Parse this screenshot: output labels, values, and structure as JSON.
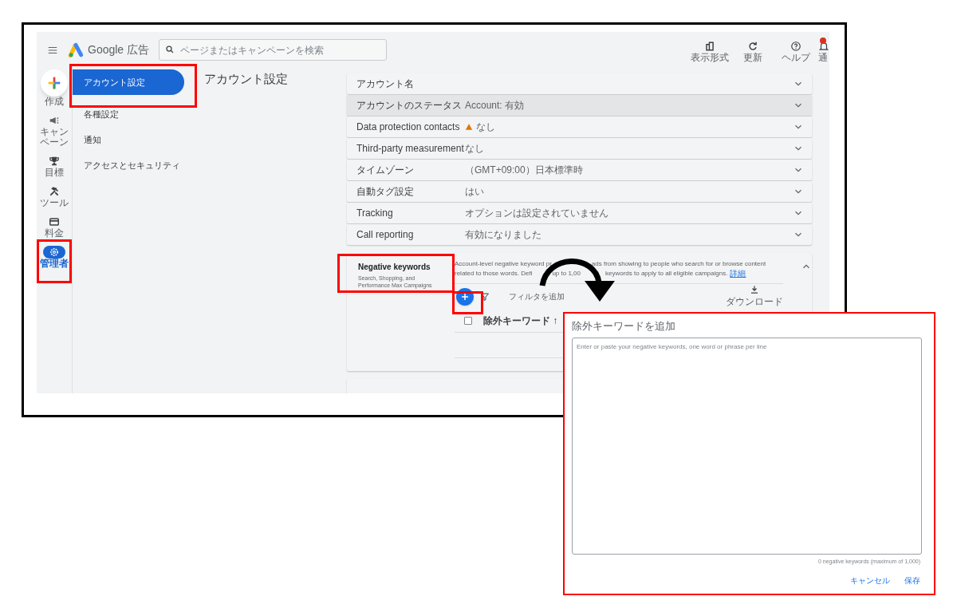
{
  "top_bar": {
    "product": "Google 広告",
    "search": {
      "placeholder": "ページまたはキャンペーンを検索"
    },
    "actions": [
      {
        "kind": "layout",
        "label": "表示形式"
      },
      {
        "kind": "refresh",
        "label": "更新"
      },
      {
        "kind": "help",
        "label": "ヘルプ"
      },
      {
        "kind": "bell",
        "label": "通",
        "badge": true
      }
    ]
  },
  "nav_rail": [
    {
      "kind": "create",
      "label": "作成",
      "selected": false
    },
    {
      "kind": "megaphone",
      "label": "キャンペーン",
      "selected": false
    },
    {
      "kind": "trophy",
      "label": "目標",
      "selected": false
    },
    {
      "kind": "tools",
      "label": "ツール",
      "selected": false
    },
    {
      "kind": "card",
      "label": "料金",
      "selected": false
    },
    {
      "kind": "gear",
      "label": "管理者",
      "selected": true
    }
  ],
  "sub_nav": [
    {
      "label": "アカウント設定",
      "selected": true
    },
    {
      "label": "各種設定",
      "selected": false
    },
    {
      "label": "通知",
      "selected": false
    },
    {
      "label": "アクセスとセキュリティ",
      "selected": false
    }
  ],
  "page_title": "アカウント設定",
  "settings": [
    {
      "label": "アカウント名",
      "highlighted": false,
      "warning": false
    },
    {
      "label": "アカウントのステータス",
      "value": "Account: 有効",
      "highlighted": true,
      "warning": false
    },
    {
      "label": "Data protection contacts",
      "value": "なし",
      "highlighted": false,
      "warning": true
    },
    {
      "label": "Third-party measurement",
      "value": "なし",
      "highlighted": false,
      "warning": false
    },
    {
      "label": "タイムゾーン",
      "value": "（GMT+09:00）日本標準時",
      "highlighted": false,
      "warning": false
    },
    {
      "label": "自動タグ設定",
      "value": "はい",
      "highlighted": false,
      "warning": false
    },
    {
      "label": "Tracking",
      "value": "オプションは設定されていません",
      "highlighted": false,
      "warning": false
    },
    {
      "label": "Call reporting",
      "value": "有効になりました",
      "highlighted": false,
      "warning": false
    }
  ],
  "negative_keywords": {
    "title": "Negative keywords",
    "subtitle": "Search, Shopping, and Performance Max Campaigns",
    "expanded": true,
    "description_lines": [
      [
        "Account-level negative keyword pr",
        "ads from showing to people who search for or browse content"
      ],
      [
        "related to those words. Defi",
        "up to 1,00",
        "keywords to apply to all eligible campaigns."
      ]
    ],
    "learn_more": "詳細",
    "filter": "フィルタを追加",
    "download": "ダウンロード",
    "column": "除外キーワード ↑",
    "select_all": {
      "checked": false
    }
  },
  "dialog": {
    "title": "除外キーワードを追加",
    "placeholder": "Enter or paste your negative keywords, one word or phrase per line",
    "count": "0 negative keywords (maximum of 1,000)",
    "buttons": [
      "キャンセル",
      "保存"
    ]
  }
}
